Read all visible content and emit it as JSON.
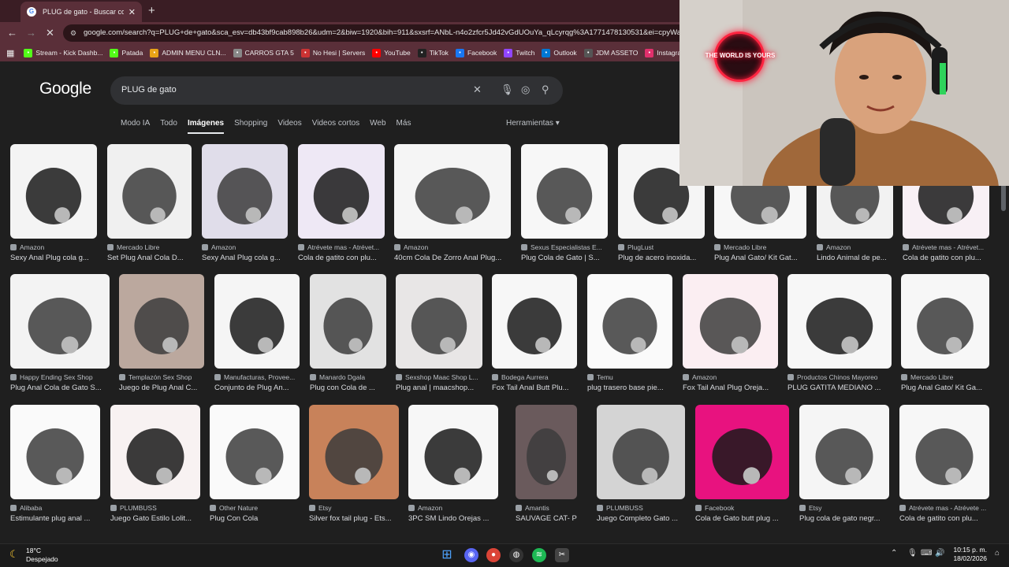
{
  "browser": {
    "tab_title": "PLUG de gato - Buscar con Goo",
    "url": "google.com/search?q=PLUG+de+gato&sca_esv=db43bf9cab898b26&udm=2&biw=1920&bih=911&sxsrf=ANbL-n4o2zfcr5Jd42vGdUOuYa_qLcyrqg%3A1771478130531&ei=cpyWadX",
    "bookmarks": [
      {
        "label": "Stream - Kick Dashb...",
        "color": "#53fc18"
      },
      {
        "label": "Patada",
        "color": "#53fc18"
      },
      {
        "label": "ADMIN MENU CLN...",
        "color": "#e8a317"
      },
      {
        "label": "CARROS GTA 5",
        "color": "#888888"
      },
      {
        "label": "No Hesi | Servers",
        "color": "#c33"
      },
      {
        "label": "YouTube",
        "color": "#ff0000"
      },
      {
        "label": "TikTok",
        "color": "#222222"
      },
      {
        "label": "Facebook",
        "color": "#1877f2"
      },
      {
        "label": "Twitch",
        "color": "#9146ff"
      },
      {
        "label": "Outlook",
        "color": "#0078d4"
      },
      {
        "label": "JDM ASSETO",
        "color": "#555555"
      },
      {
        "label": "Instagram",
        "color": "#e1306c"
      }
    ]
  },
  "google": {
    "logo": "Google",
    "query": "PLUG de gato",
    "tabs": [
      "Modo IA",
      "Todo",
      "Imágenes",
      "Shopping",
      "Videos",
      "Videos cortos",
      "Web",
      "Más"
    ],
    "tools": "Herramientas"
  },
  "overlay": {
    "neon_text": "THE WORLD IS YOURS"
  },
  "results": [
    {
      "source": "Amazon",
      "title": "Sexy Anal Plug cola g...",
      "color": "#f4f4f4"
    },
    {
      "source": "Mercado Libre",
      "title": "Set Plug Anal Cola D...",
      "color": "#f0f0f0"
    },
    {
      "source": "Amazon",
      "title": "Sexy Anal Plug cola g...",
      "color": "#e0ddea"
    },
    {
      "source": "Atrévete mas - Atrévet...",
      "title": "Cola de gatito con plu...",
      "color": "#eee8f5"
    },
    {
      "source": "Amazon",
      "title": "40cm Cola De Zorro Anal Plug...",
      "color": "#f5f5f5"
    },
    {
      "source": "Sexus Especialistas E...",
      "title": "Plug Cola de Gato | S...",
      "color": "#f7f7f7"
    },
    {
      "source": "PlugLust",
      "title": "Plug de acero inoxida...",
      "color": "#f5f5f5"
    },
    {
      "source": "Mercado Libre",
      "title": "Plug Anal Gato/ Kit Gat...",
      "color": "#f7f7f7"
    },
    {
      "source": "Amazon",
      "title": "Lindo Animal de pe...",
      "color": "#f2f2f2"
    },
    {
      "source": "Atrévete mas - Atrévet...",
      "title": "Cola de gatito con plu...",
      "color": "#f8f0f5"
    },
    {
      "source": "Happy Ending Sex Shop",
      "title": "Plug Anal Cola de Gato S...",
      "color": "#f3f3f3"
    },
    {
      "source": "Templazón Sex Shop",
      "title": "Juego de Plug Anal C...",
      "color": "#bba89e"
    },
    {
      "source": "Manufacturas, Provee...",
      "title": "Conjunto de Plug An...",
      "color": "#f5f5f5"
    },
    {
      "source": "Manardo Dgala",
      "title": "Plug con Cola de ...",
      "color": "#e2e2e2"
    },
    {
      "source": "Sexshop Maac Shop L...",
      "title": "Plug anal | maacshop...",
      "color": "#e8e6e6"
    },
    {
      "source": "Bodega Aurrera",
      "title": "Fox Tail Anal Butt Plu...",
      "color": "#f7f7f7"
    },
    {
      "source": "Temu",
      "title": "plug trasero base pie...",
      "color": "#fafafa"
    },
    {
      "source": "Amazon",
      "title": "Fox Tail Anal Plug Oreja...",
      "color": "#fbeef2"
    },
    {
      "source": "Productos Chinos Mayoreo",
      "title": "PLUG GATITA MEDIANO ...",
      "color": "#f7f7f7"
    },
    {
      "source": "Mercado Libre",
      "title": "Plug Anal Gato/ Kit Ga...",
      "color": "#f7f7f7"
    },
    {
      "source": "Alibaba",
      "title": "Estimulante plug anal ...",
      "color": "#fafafa"
    },
    {
      "source": "PLUMBUSS",
      "title": "Juego Gato Estilo Lolit...",
      "color": "#f8f2f2"
    },
    {
      "source": "Other Nature",
      "title": "Plug Con Cola",
      "color": "#fafafa"
    },
    {
      "source": "Etsy",
      "title": "Silver fox tail plug - Ets...",
      "color": "#c8825a"
    },
    {
      "source": "Amazon",
      "title": "3PC SM Lindo Orejas ...",
      "color": "#f7f7f7"
    },
    {
      "source": "Amantis",
      "title": "SAUVAGE CAT- Pl...",
      "color": "#6a5a5c"
    },
    {
      "source": "PLUMBUSS",
      "title": "Juego Completo Gato ...",
      "color": "#d4d4d4"
    },
    {
      "source": "Facebook",
      "title": "Cola de Gato butt plug ...",
      "color": "#e8127f"
    },
    {
      "source": "Etsy",
      "title": "Plug cola de gato negr...",
      "color": "#f5f5f5"
    },
    {
      "source": "Atrévete mas - Atrévete ...",
      "title": "Cola de gatito con plu...",
      "color": "#f7f7f7"
    }
  ],
  "taskbar": {
    "weather_temp": "18°C",
    "weather_desc": "Despejado",
    "time": "10:15 p. m.",
    "date": "18/02/2026"
  }
}
